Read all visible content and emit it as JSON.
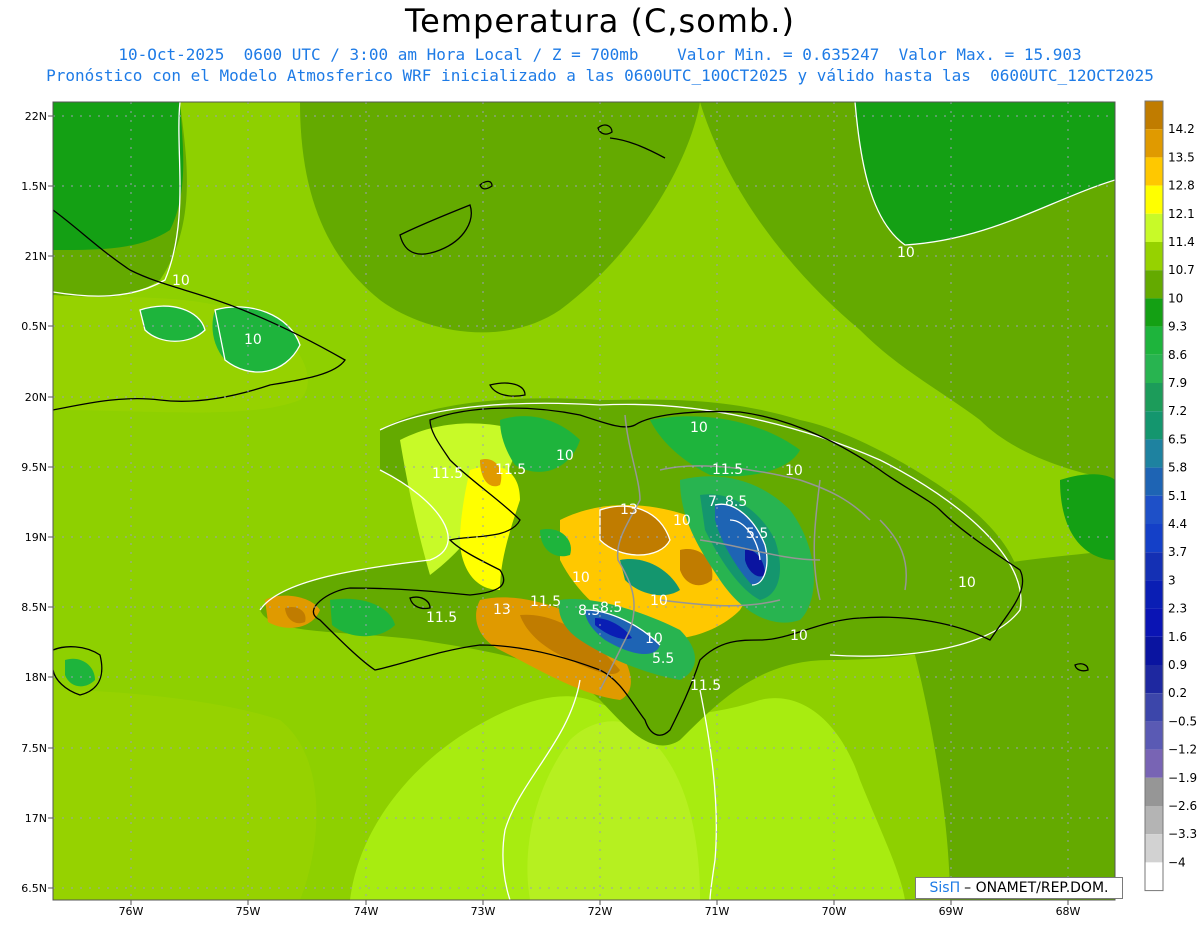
{
  "title": "Temperatura (C,somb.)",
  "subtitle_1": "10-Oct-2025  0600 UTC / 3:00 am Hora Local / Z = 700mb    Valor Min. = 0.635247  Valor Max. = 15.903",
  "subtitle_2": "Pronóstico con el Modelo Atmosferico WRF inicializado a las 0600UTC_10OCT2025 y válido hasta las  0600UTC_12OCT2025",
  "credit": {
    "brand": "SisΠ",
    "text": "– ONAMET/REP.DOM."
  },
  "axes": {
    "lon_labels": [
      "76W",
      "75W",
      "74W",
      "73W",
      "72W",
      "71W",
      "70W",
      "69W",
      "68W"
    ],
    "lat_labels": [
      "22N",
      "1.5N",
      "21N",
      "0.5N",
      "20N",
      "9.5N",
      "19N",
      "8.5N",
      "18N",
      "7.5N",
      "17N",
      "6.5N"
    ]
  },
  "colorbar": {
    "labels": [
      "14.2",
      "13.5",
      "12.8",
      "12.1",
      "11.4",
      "10.7",
      "10",
      "9.3",
      "8.6",
      "7.9",
      "7.2",
      "6.5",
      "5.8",
      "5.1",
      "4.4",
      "3.7",
      "3",
      "2.3",
      "1.6",
      "0.9",
      "0.2",
      "−0.5",
      "−1.2",
      "−1.9",
      "−2.6",
      "−3.3",
      "−4"
    ],
    "colors": [
      "#c07c00",
      "#e09a00",
      "#ffc800",
      "#ffff00",
      "#c8fa28",
      "#96d200",
      "#64aa00",
      "#14a014",
      "#1eb43c",
      "#28b450",
      "#1c9c5a",
      "#14966e",
      "#1e82a0",
      "#1e64b4",
      "#1e50c8",
      "#1440c8",
      "#1430b4",
      "#0a1eb4",
      "#0a14b4",
      "#0a14a0",
      "#1e28a0",
      "#3c46aa",
      "#5a5ab4",
      "#7864b4",
      "#969696",
      "#b4b4b4",
      "#d2d2d2",
      "#ffffff"
    ]
  },
  "contour_labels": [
    "10",
    "10",
    "10",
    "10",
    "11.5",
    "11.5",
    "10",
    "11.5",
    "13",
    "7",
    "8.5",
    "10",
    "5.5",
    "10",
    "8.5",
    "10",
    "11.5",
    "13",
    "11.5",
    "8.5",
    "5.5",
    "10",
    "11.5",
    "10",
    "10",
    "10"
  ]
}
